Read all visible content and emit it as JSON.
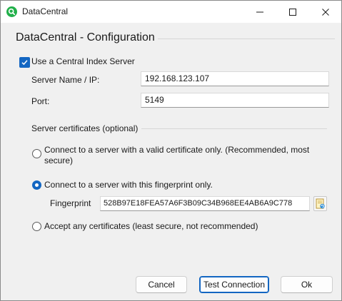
{
  "window": {
    "title": "DataCentral",
    "accent_color": "#1366c2",
    "app_icon": "search-magnifier-icon"
  },
  "header": {
    "title": "DataCentral - Configuration"
  },
  "central_index": {
    "checkbox_label": "Use a Central Index Server",
    "checked": true,
    "server_label": "Server Name / IP:",
    "server_value": "192.168.123.107",
    "port_label": "Port:",
    "port_value": "5149"
  },
  "certificates": {
    "section_label": "Server certificates (optional)",
    "options": [
      {
        "label": "Connect to a server with a valid certificate only. (Recommended, most secure)",
        "selected": false
      },
      {
        "label": "Connect to a server with this fingerprint only.",
        "selected": true
      },
      {
        "label": "Accept any certificates (least secure, not recommended)",
        "selected": false
      }
    ],
    "fingerprint_label": "Fingerprint",
    "fingerprint_value": "528B97E18FEA57A6F3B09C34B968EE4AB6A9C778"
  },
  "buttons": {
    "cancel": "Cancel",
    "test": "Test Connection",
    "ok": "Ok"
  }
}
